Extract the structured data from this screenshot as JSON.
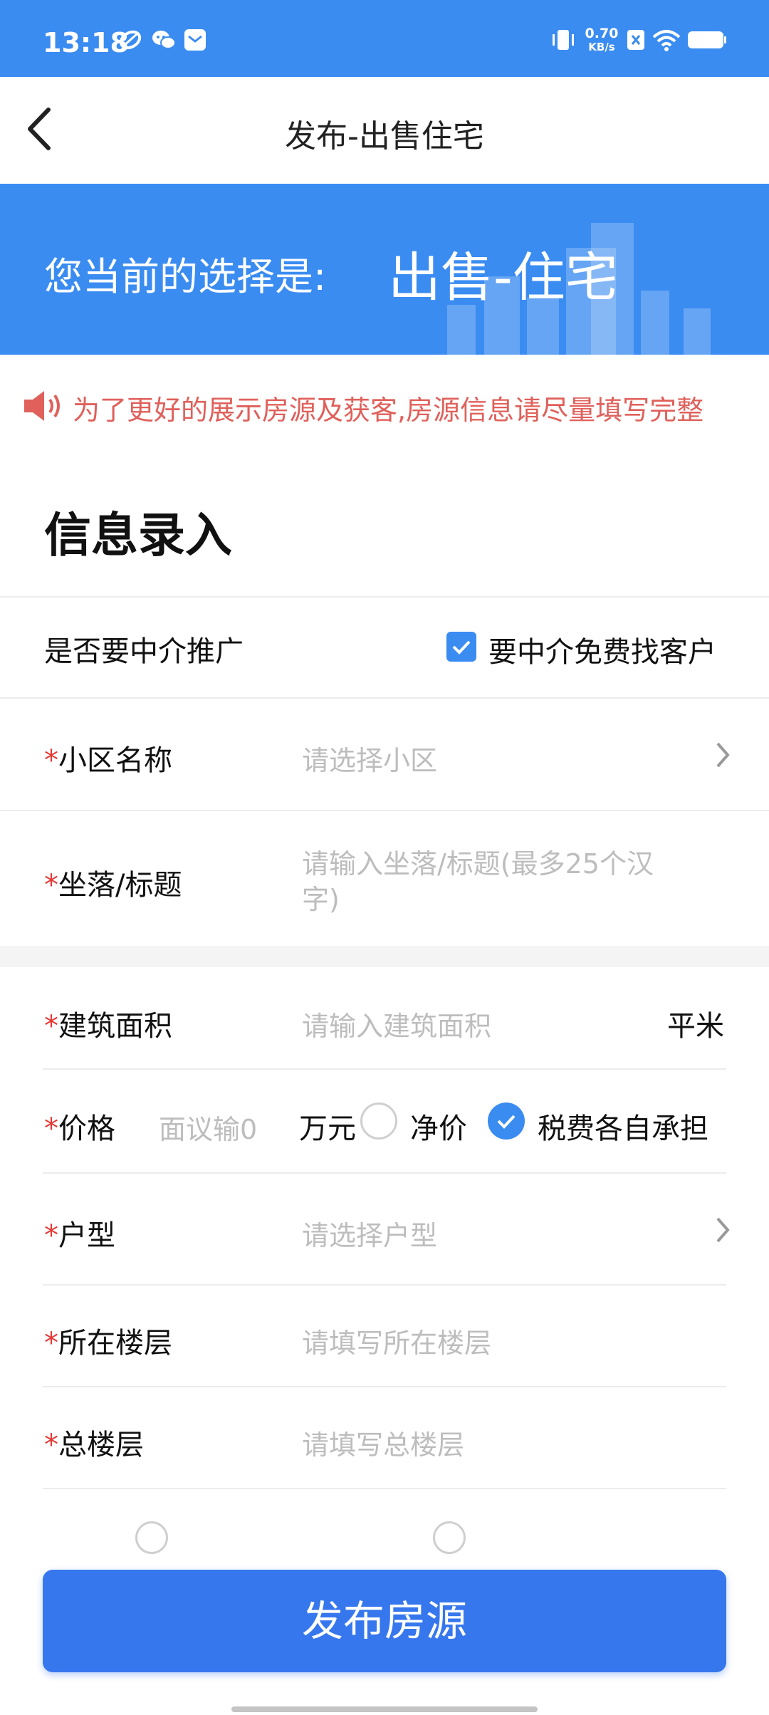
{
  "status_bar": {
    "time": "13:18",
    "net_speed_value": "0.70",
    "net_speed_unit": "KB/s",
    "icons": [
      "app-icon",
      "wechat-icon",
      "message-icon",
      "vibrate-icon",
      "sim-off-icon",
      "wifi-icon",
      "battery-icon"
    ]
  },
  "nav": {
    "title": "发布-出售住宅"
  },
  "banner": {
    "label": "您当前的选择是:",
    "value": "出售-住宅"
  },
  "notice": {
    "text": "为了更好的展示房源及获客,房源信息请尽量填写完整"
  },
  "section": {
    "title": "信息录入"
  },
  "form": {
    "agent_promo": {
      "label": "是否要中介推广",
      "option": "要中介免费找客户",
      "checked": true
    },
    "community": {
      "required": "*",
      "label": "小区名称",
      "placeholder": "请选择小区"
    },
    "location": {
      "required": "*",
      "label": "坐落/标题",
      "placeholder_line1": "请输入坐落/标题(最多25个汉",
      "placeholder_line2": "字)"
    },
    "area": {
      "required": "*",
      "label": "建筑面积",
      "placeholder": "请输入建筑面积",
      "unit": "平米"
    },
    "price": {
      "required": "*",
      "label": "价格",
      "placeholder": "面议输0",
      "unit": "万元",
      "option_net": "净价",
      "option_net_selected": false,
      "option_tax": "税费各自承担",
      "option_tax_selected": true
    },
    "layout": {
      "required": "*",
      "label": "户型",
      "placeholder": "请选择户型"
    },
    "floor": {
      "required": "*",
      "label": "所在楼层",
      "placeholder": "请填写所在楼层"
    },
    "total_floors": {
      "required": "*",
      "label": "总楼层",
      "placeholder": "请填写总楼层"
    }
  },
  "publish_button": {
    "label": "发布房源"
  },
  "colors": {
    "primary": "#3a8cf1",
    "button": "#3677ee",
    "required": "#e53935",
    "notice": "#e0605b",
    "placeholder": "#bdbdbd"
  }
}
